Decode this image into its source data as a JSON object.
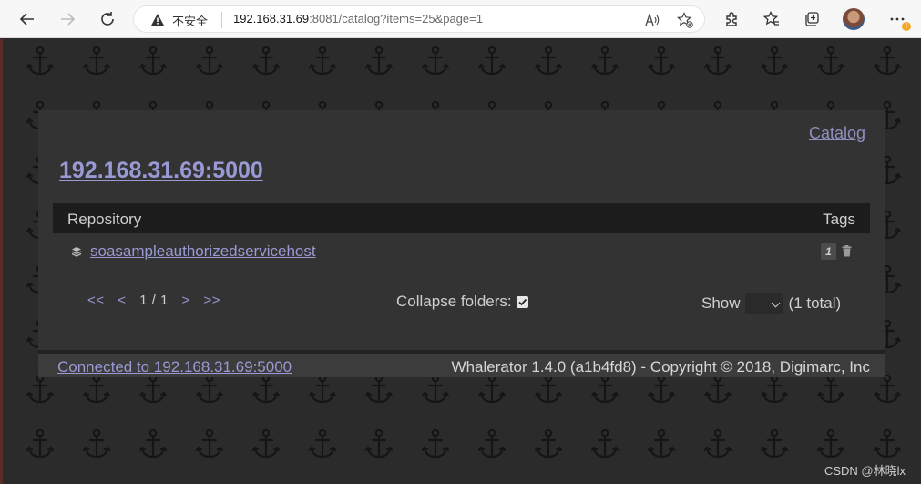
{
  "browser": {
    "security_label": "不安全",
    "url_host": "192.168.31.69",
    "url_rest": ":8081/catalog?items=25&page=1"
  },
  "header": {
    "catalog_link": "Catalog",
    "registry_title": "192.168.31.69:5000"
  },
  "table": {
    "col_repository": "Repository",
    "col_tags": "Tags",
    "rows": [
      {
        "repository": "soasampleauthorizedservicehost",
        "tag_count": "1"
      }
    ]
  },
  "pagination": {
    "first": "<<",
    "prev": "<",
    "page_info": "1 / 1",
    "next": ">",
    "last": ">>"
  },
  "collapse_folders": {
    "label": "Collapse folders:",
    "checked": true
  },
  "show": {
    "label": "Show",
    "selected": "",
    "total": "(1 total)"
  },
  "footer": {
    "connected": "Connected to 192.168.31.69:5000",
    "copyright": "Whalerator 1.4.0 (a1b4fd8) - Copyright © 2018, Digimarc, Inc"
  },
  "watermark": "CSDN @林晓lx",
  "colors": {
    "link": "#9999d4",
    "panel": "#333333",
    "header_bar": "#1c1c1c"
  }
}
